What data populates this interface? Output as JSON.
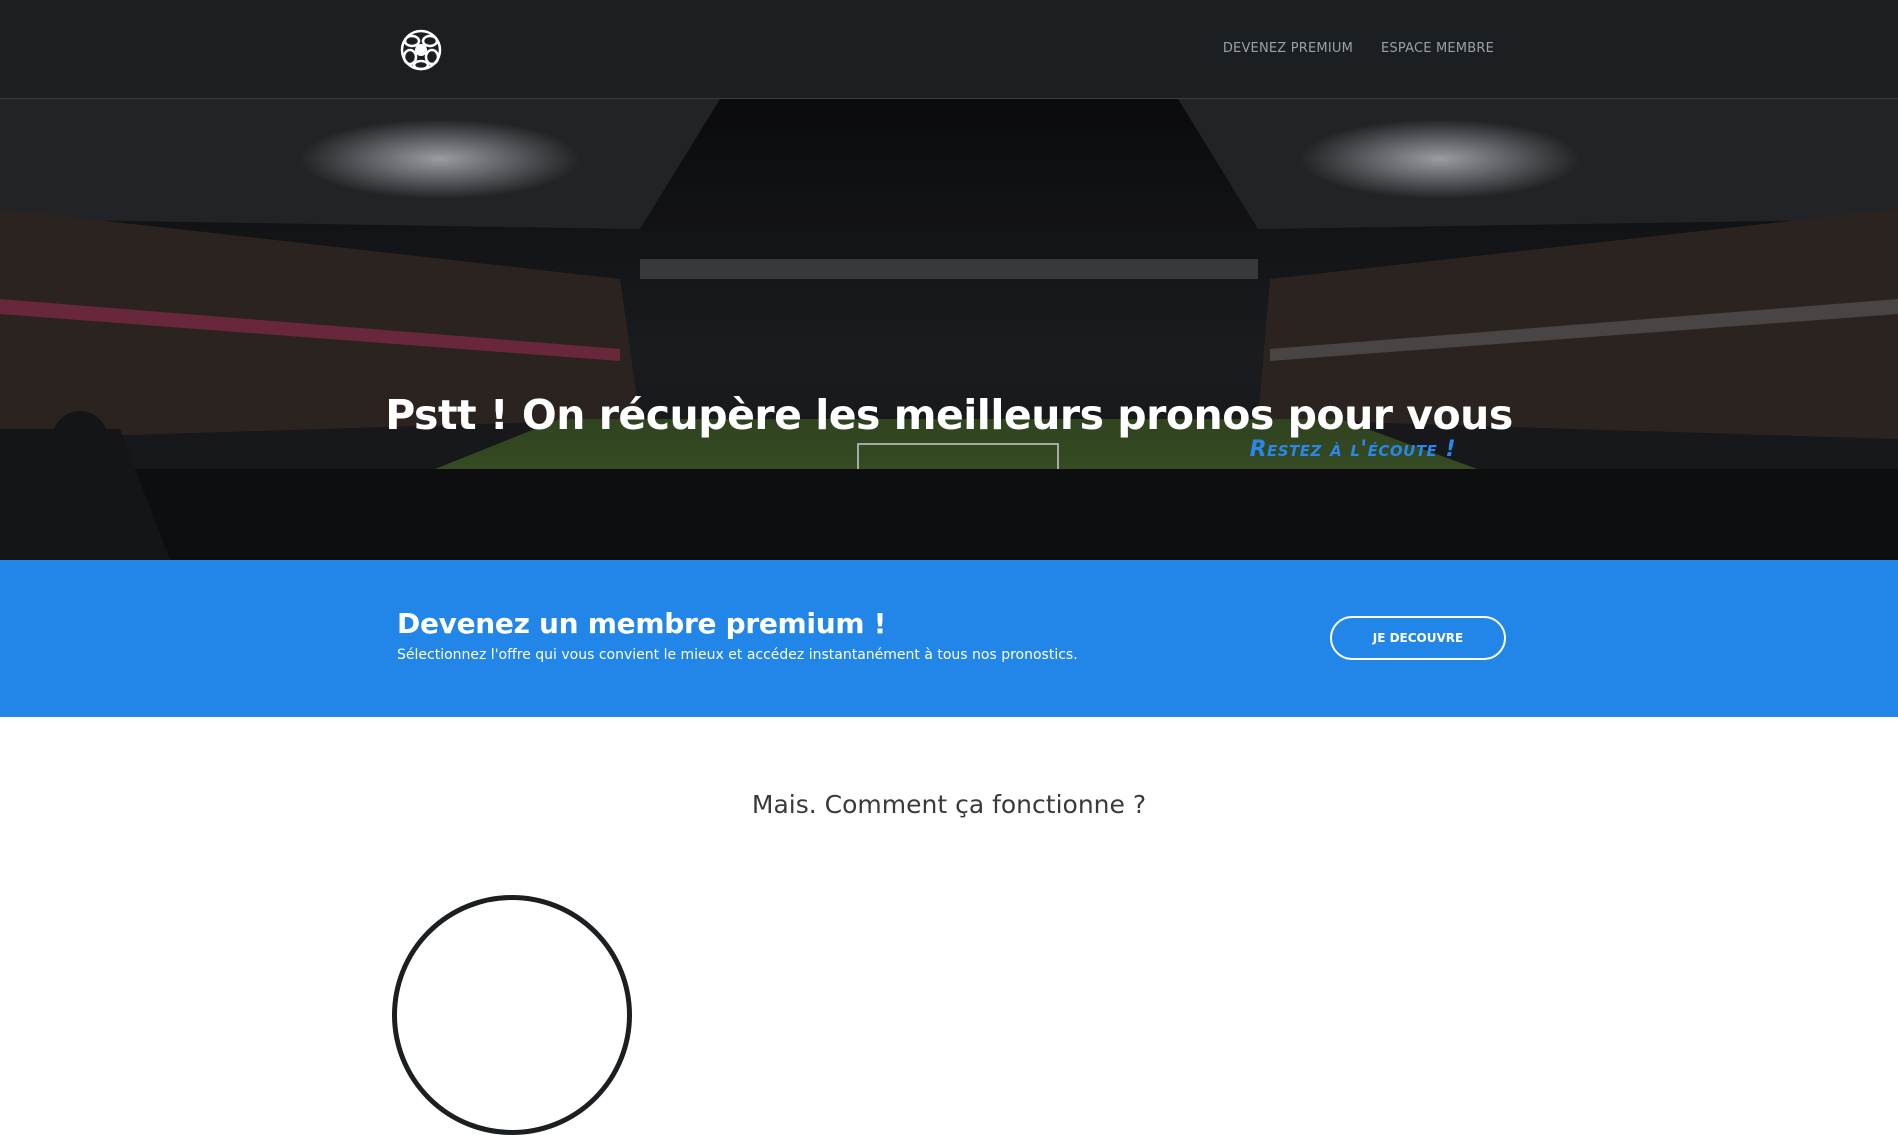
{
  "navbar": {
    "logo_icon": "soccer-ball-logo-icon",
    "links": [
      {
        "label": "DEVENEZ PREMIUM"
      },
      {
        "label": "ESPACE MEMBRE"
      }
    ]
  },
  "hero": {
    "title": "Pstt ! On récupère les meilleurs pronos pour vous",
    "subtitle": "Restez à l'écoute !",
    "background": "stadium-night-photo"
  },
  "premium": {
    "title": "Devenez un membre premium !",
    "description": "Sélectionnez l'offre qui vous convient le mieux et accédez instantanément à tous nos pronostics.",
    "button_label": "JE DECOUVRE"
  },
  "how_it_works": {
    "title": "Mais. Comment ça fonctionne ?"
  },
  "colors": {
    "navbar_bg": "#1c1f22",
    "accent_blue": "#2286e9",
    "subtitle_blue": "#2a86e8",
    "white": "#ffffff"
  }
}
